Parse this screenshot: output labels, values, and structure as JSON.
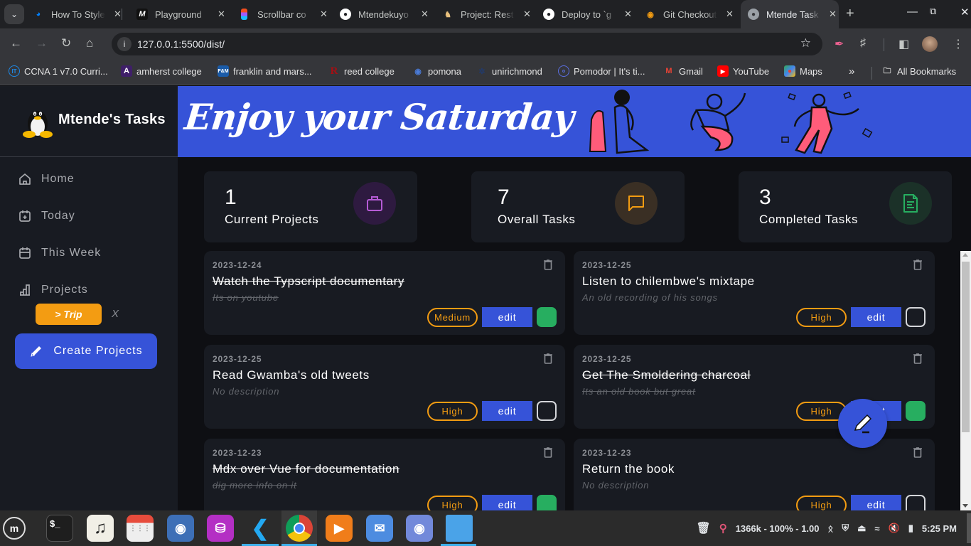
{
  "browser": {
    "tabs": [
      {
        "title": "How To Style",
        "icon": "digitalocean-icon",
        "active": false
      },
      {
        "title": "Playground",
        "icon": "m-logo-icon",
        "active": false
      },
      {
        "title": "Scrollbar co",
        "icon": "figma-icon",
        "active": false
      },
      {
        "title": "Mtendekuyo",
        "icon": "github-icon",
        "active": false
      },
      {
        "title": "Project: Rest",
        "icon": "odin-icon",
        "active": false
      },
      {
        "title": "Deploy to `g",
        "icon": "github-icon",
        "active": false
      },
      {
        "title": "Git Checkout",
        "icon": "git-icon",
        "active": false
      },
      {
        "title": "Mtende Task",
        "icon": "globe-icon",
        "active": true
      }
    ],
    "url": "127.0.0.1:5500/dist/",
    "bookmarks": [
      {
        "label": "CCNA 1 v7.0 Curri...",
        "icon": "it-icon"
      },
      {
        "label": "amherst college",
        "icon": "amherst-icon"
      },
      {
        "label": "franklin and mars...",
        "icon": "fm-icon"
      },
      {
        "label": "reed college",
        "icon": "reed-icon"
      },
      {
        "label": "pomona",
        "icon": "pomona-icon"
      },
      {
        "label": "unirichmond",
        "icon": "spider-icon"
      },
      {
        "label": "Pomodor | It's ti...",
        "icon": "pomodoro-icon"
      },
      {
        "label": "Gmail",
        "icon": "gmail-icon"
      },
      {
        "label": "YouTube",
        "icon": "youtube-icon"
      },
      {
        "label": "Maps",
        "icon": "maps-icon"
      }
    ],
    "more_bookmarks": "»",
    "all_bookmarks": "All Bookmarks"
  },
  "app": {
    "brand": "Mtende's Tasks",
    "banner": "Enjoy your Saturday",
    "nav": [
      {
        "label": "Home",
        "icon": "home-icon"
      },
      {
        "label": "Today",
        "icon": "calendar-plus-icon"
      },
      {
        "label": "This Week",
        "icon": "calendar-week-icon"
      },
      {
        "label": "Projects",
        "icon": "bar-chart-icon"
      }
    ],
    "projects": [
      {
        "label": "> Trip",
        "remove": "X"
      }
    ],
    "create_button": "Create Projects",
    "stats": [
      {
        "value": "1",
        "label": "Current Projects",
        "icon": "briefcase-icon",
        "color": "#b65bd6"
      },
      {
        "value": "7",
        "label": "Overall Tasks",
        "icon": "chat-icon",
        "color": "#f39c12"
      },
      {
        "value": "3",
        "label": "Completed Tasks",
        "icon": "document-icon",
        "color": "#27ae60"
      }
    ],
    "tasks": [
      {
        "date": "2023-12-24",
        "title": "Watch the Typscript documentary",
        "description": "Its on youtube",
        "priority": "Medium",
        "edit": "edit",
        "completed": true
      },
      {
        "date": "2023-12-25",
        "title": "Listen to chilembwe's mixtape",
        "description": "An old recording of his songs",
        "priority": "High",
        "edit": "edit",
        "completed": false
      },
      {
        "date": "2023-12-25",
        "title": "Read Gwamba's old tweets",
        "description": "No description",
        "priority": "High",
        "edit": "edit",
        "completed": false
      },
      {
        "date": "2023-12-25",
        "title": "Get The Smoldering charcoal",
        "description": "Its an old book but great",
        "priority": "High",
        "edit": "edit",
        "completed": true
      },
      {
        "date": "2023-12-23",
        "title": "Mdx over Vue for documentation",
        "description": "dig more info on it",
        "priority": "High",
        "edit": "edit",
        "completed": true
      },
      {
        "date": "2023-12-23",
        "title": "Return the book",
        "description": "No description",
        "priority": "High",
        "edit": "edit",
        "completed": false
      }
    ],
    "colors": {
      "accent": "#3653d8",
      "priority": "#f39c12",
      "done": "#27ae60",
      "sidebar": "#181b22"
    }
  },
  "taskbar": {
    "apps": [
      "menu",
      "terminal",
      "music",
      "calendar",
      "screenshot",
      "database",
      "vscode",
      "chrome",
      "media-player",
      "mail",
      "discord",
      "files"
    ],
    "status": "1366k - 100% - 1.00",
    "clock": "5:25 PM"
  }
}
